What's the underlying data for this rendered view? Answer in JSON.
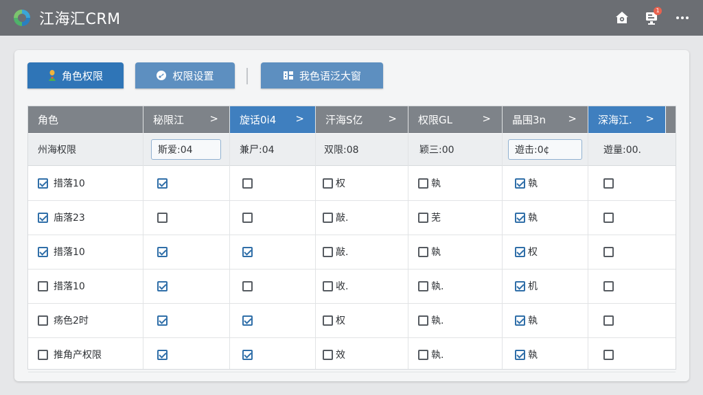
{
  "app": {
    "title": "江海汇CRM",
    "notification_count": "1",
    "colors": {
      "topbar": "#6b6e73",
      "tab_active": "#2f75b7",
      "tab_inactive": "#5d8fc0",
      "header_dark": "#7e8389",
      "header_blue": "#3f7fbf"
    }
  },
  "tabs": [
    {
      "label": "角色权限",
      "icon": "role-icon",
      "active": true
    },
    {
      "label": "权限设置",
      "icon": "settings-icon",
      "active": false
    },
    {
      "label": "我色语泛大窗",
      "icon": "grid-icon",
      "active": false
    }
  ],
  "columns": [
    {
      "label": "角色",
      "arrow": ""
    },
    {
      "label": "秘限江",
      "arrow": ">"
    },
    {
      "label": "旋话0i4",
      "arrow": ">"
    },
    {
      "label": "汗海S亿",
      "arrow": ">"
    },
    {
      "label": "权限GL",
      "arrow": ">"
    },
    {
      "label": "晶围3n",
      "arrow": ">"
    },
    {
      "label": "深海江.",
      "arrow": ">"
    }
  ],
  "filters": [
    {
      "value": "州海权限",
      "boxed": false
    },
    {
      "value": "斯爱:04",
      "boxed": true
    },
    {
      "value": "兼尸:04",
      "boxed": false
    },
    {
      "value": "双限:08",
      "boxed": false
    },
    {
      "value": "颖三:00",
      "boxed": false
    },
    {
      "value": "遊击:0¢",
      "boxed": true
    },
    {
      "value": "遊量:00.",
      "boxed": false
    }
  ],
  "rows": [
    {
      "name": "措落10",
      "name_checked": true,
      "cells": [
        {
          "checked": true,
          "label": ""
        },
        {
          "checked": false,
          "label": ""
        },
        {
          "checked": false,
          "label": "权"
        },
        {
          "checked": false,
          "label": "執"
        },
        {
          "checked": true,
          "label": "執"
        },
        {
          "checked": false,
          "label": ""
        }
      ]
    },
    {
      "name": "庙落23",
      "name_checked": true,
      "cells": [
        {
          "checked": false,
          "label": ""
        },
        {
          "checked": false,
          "label": ""
        },
        {
          "checked": false,
          "label": "敲."
        },
        {
          "checked": false,
          "label": "芜"
        },
        {
          "checked": true,
          "label": "執"
        },
        {
          "checked": false,
          "label": ""
        }
      ]
    },
    {
      "name": "措落10",
      "name_checked": true,
      "cells": [
        {
          "checked": true,
          "label": ""
        },
        {
          "checked": true,
          "label": ""
        },
        {
          "checked": false,
          "label": "敲."
        },
        {
          "checked": false,
          "label": "執"
        },
        {
          "checked": true,
          "label": "权"
        },
        {
          "checked": false,
          "label": ""
        }
      ]
    },
    {
      "name": "措落10",
      "name_checked": false,
      "cells": [
        {
          "checked": true,
          "label": ""
        },
        {
          "checked": false,
          "label": ""
        },
        {
          "checked": false,
          "label": "收."
        },
        {
          "checked": false,
          "label": "執."
        },
        {
          "checked": true,
          "label": "机"
        },
        {
          "checked": false,
          "label": ""
        }
      ]
    },
    {
      "name": "疡色2时",
      "name_checked": false,
      "cells": [
        {
          "checked": true,
          "label": ""
        },
        {
          "checked": true,
          "label": ""
        },
        {
          "checked": false,
          "label": "权"
        },
        {
          "checked": false,
          "label": "執."
        },
        {
          "checked": true,
          "label": "執"
        },
        {
          "checked": false,
          "label": ""
        }
      ]
    },
    {
      "name": "推角产权限",
      "name_checked": false,
      "cells": [
        {
          "checked": true,
          "label": ""
        },
        {
          "checked": true,
          "label": ""
        },
        {
          "checked": false,
          "label": "效"
        },
        {
          "checked": false,
          "label": "執."
        },
        {
          "checked": true,
          "label": "執"
        },
        {
          "checked": false,
          "label": ""
        }
      ]
    }
  ]
}
